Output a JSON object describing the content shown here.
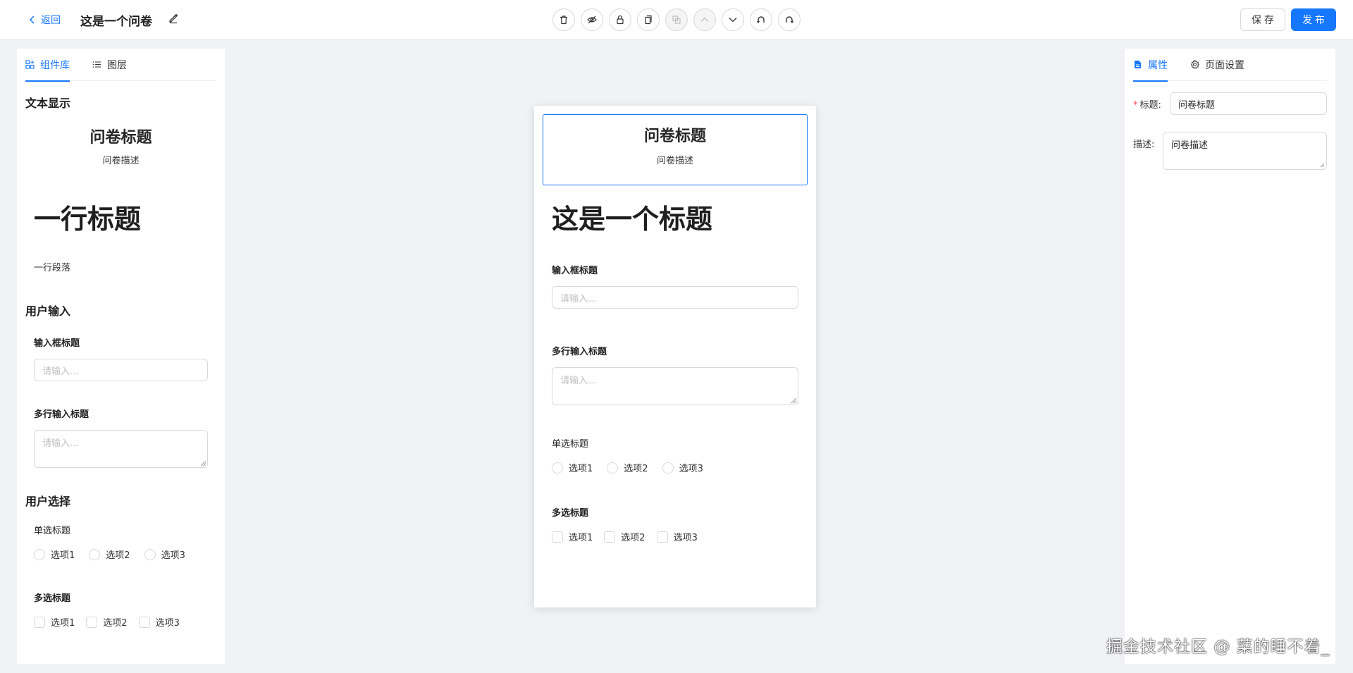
{
  "header": {
    "back_label": "返回",
    "title": "这是一个问卷",
    "save_label": "保 存",
    "publish_label": "发 布",
    "toolbar_icons": [
      "delete-icon",
      "hide-icon",
      "lock-icon",
      "copy-icon",
      "paste-icon",
      "move-up-icon",
      "move-down-icon",
      "undo-icon",
      "redo-icon"
    ],
    "accent_color": "#1677ff"
  },
  "left_panel": {
    "tabs": [
      {
        "label": "组件库",
        "active": true
      },
      {
        "label": "图层",
        "active": false
      }
    ],
    "groups": {
      "text_display": {
        "title": "文本显示",
        "question_title": "问卷标题",
        "question_desc": "问卷描述",
        "line_title": "一行标题",
        "paragraph": "一行段落"
      },
      "user_input": {
        "title": "用户输入",
        "input_label": "输入框标题",
        "input_placeholder": "请输入...",
        "textarea_label": "多行输入标题",
        "textarea_placeholder": "请输入..."
      },
      "user_choice": {
        "title": "用户选择",
        "radio_label": "单选标题",
        "radio_options": [
          "选项1",
          "选项2",
          "选项3"
        ],
        "checkbox_label": "多选标题",
        "checkbox_options": [
          "选项1",
          "选项2",
          "选项3"
        ]
      }
    }
  },
  "canvas": {
    "question_title": "问卷标题",
    "question_desc": "问卷描述",
    "heading": "这是一个标题",
    "input_label": "输入框标题",
    "input_placeholder": "请输入...",
    "textarea_label": "多行输入标题",
    "textarea_placeholder": "请输入...",
    "radio_label": "单选标题",
    "radio_options": [
      "选项1",
      "选项2",
      "选项3"
    ],
    "checkbox_label": "多选标题",
    "checkbox_options": [
      "选项1",
      "选项2",
      "选项3"
    ]
  },
  "right_panel": {
    "tabs": [
      {
        "label": "属性",
        "active": true
      },
      {
        "label": "页面设置",
        "active": false
      }
    ],
    "title_label": "标题:",
    "title_value": "问卷标题",
    "desc_label": "描述:",
    "desc_value": "问卷描述"
  },
  "watermark": "掘金技术社区 @ 菜的睡不着_"
}
